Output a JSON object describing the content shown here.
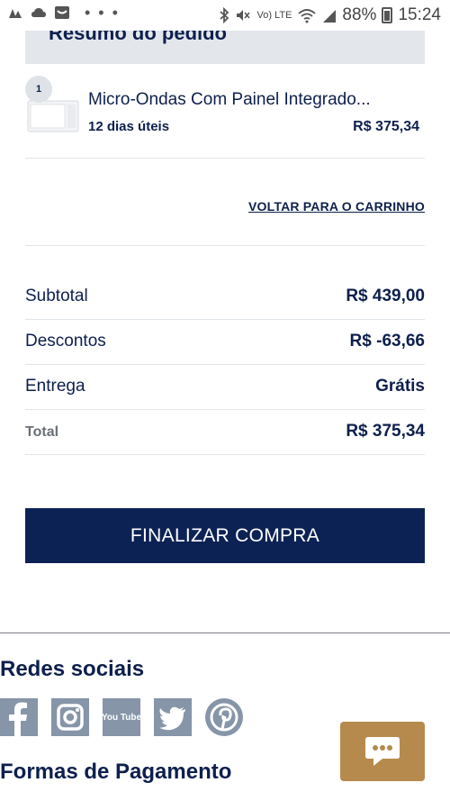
{
  "status_bar": {
    "left_icons": [
      "tree-notification-icon",
      "cloud-notification-icon",
      "inbox-notification-icon"
    ],
    "overflow": "• • •",
    "volte": "Vo) LTE",
    "battery": "88%",
    "time": "15:24"
  },
  "summary": {
    "title": "Resumo do pedido"
  },
  "product": {
    "quantity": "1",
    "name": "Micro-Ondas Com Painel Integrado...",
    "delivery": "12 dias úteis",
    "price": "R$ 375,34"
  },
  "back_to_cart": "VOLTAR PARA O CARRINHO",
  "totals": {
    "rows": [
      {
        "label": "Subtotal",
        "value": "R$ 439,00"
      },
      {
        "label": "Descontos",
        "value": "R$ -63,66"
      },
      {
        "label": "Entrega",
        "value": "Grátis"
      },
      {
        "label": "Total",
        "value": "R$ 375,34"
      }
    ]
  },
  "checkout_button": "FINALIZAR COMPRA",
  "footer": {
    "social_title": "Redes sociais",
    "social_icons": [
      "facebook-icon",
      "instagram-icon",
      "youtube-icon",
      "twitter-icon",
      "pinterest-icon"
    ],
    "youtube_text": "You Tube",
    "payment_title": "Formas de Pagamento"
  },
  "colors": {
    "brand_navy": "#0d2254",
    "text_navy": "#0d1f4d",
    "header_bg": "#e3e7ec",
    "social_gray": "#8695a8",
    "chat_gold": "#b68a4c"
  }
}
